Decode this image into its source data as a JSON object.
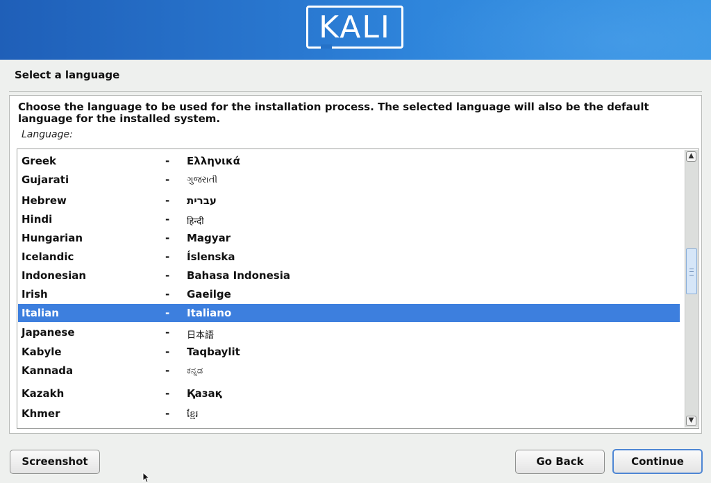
{
  "banner": {
    "logo_text": "KALI"
  },
  "page_title": "Select a language",
  "description": "Choose the language to be used for the installation process. The selected language will also be the default language for the installed system.",
  "field_label": "Language:",
  "languages": [
    {
      "name": "Greek",
      "sep": "-",
      "native": "Ελληνικά"
    },
    {
      "name": "Gujarati",
      "sep": "-",
      "native": "ગુજરાતી"
    },
    {
      "name": "Hebrew",
      "sep": "-",
      "native": "עברית"
    },
    {
      "name": "Hindi",
      "sep": "-",
      "native": "हिन्दी"
    },
    {
      "name": "Hungarian",
      "sep": "-",
      "native": "Magyar"
    },
    {
      "name": "Icelandic",
      "sep": "-",
      "native": "Íslenska"
    },
    {
      "name": "Indonesian",
      "sep": "-",
      "native": "Bahasa Indonesia"
    },
    {
      "name": "Irish",
      "sep": "-",
      "native": "Gaeilge"
    },
    {
      "name": "Italian",
      "sep": "-",
      "native": "Italiano",
      "selected": true
    },
    {
      "name": "Japanese",
      "sep": "-",
      "native": "日本語"
    },
    {
      "name": "Kabyle",
      "sep": "-",
      "native": "Taqbaylit"
    },
    {
      "name": "Kannada",
      "sep": "-",
      "native": "ಕನ್ನಡ"
    },
    {
      "name": "Kazakh",
      "sep": "-",
      "native": "Қазақ"
    },
    {
      "name": "Khmer",
      "sep": "-",
      "native": "ខ្មែរ"
    }
  ],
  "scrollbar": {
    "up_icon": "▲",
    "down_icon": "▼"
  },
  "buttons": {
    "screenshot": "Screenshot",
    "go_back": "Go Back",
    "continue": "Continue"
  },
  "colors": {
    "banner": "#2a7ad2",
    "selection": "#3d7fde",
    "continue_border": "#4d86d4"
  }
}
